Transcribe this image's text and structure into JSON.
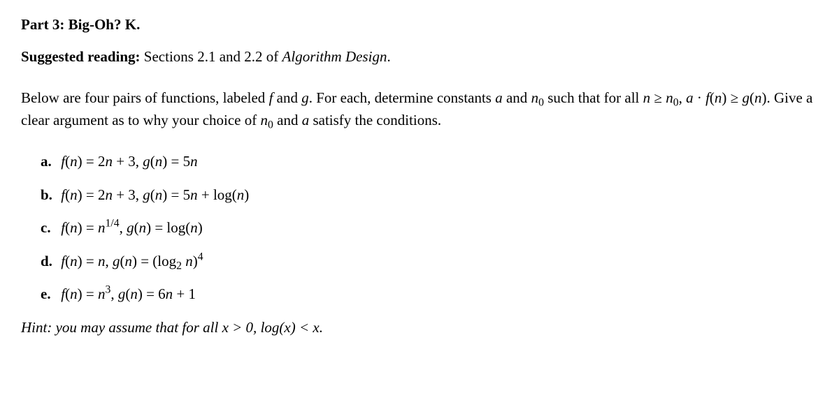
{
  "heading": "Part 3: Big-Oh? K.",
  "reading": {
    "label": "Suggested reading:",
    "text_before": " Sections 2.1 and 2.2 of ",
    "book": "Algorithm Design",
    "text_after": "."
  },
  "instructions": {
    "l1_a": "Below are four pairs of functions, labeled ",
    "l1_b": " and ",
    "l1_c": ". For each, determine constants ",
    "l1_d": " and ",
    "l1_e": " such that for all ",
    "l2_a": ", ",
    "l2_b": ". Give a clear argument as to why your choice of ",
    "l2_c": " and ",
    "l2_d": " satisfy the conditions.",
    "f": "f",
    "g": "g",
    "a": "a",
    "n0": "n",
    "n0_sub": "0",
    "cond1_a": "n",
    "cond1_b": " ≥ ",
    "cond1_c": "n",
    "cond2_a": "a",
    "cond2_b": " · ",
    "cond2_c": "f",
    "cond2_d": "(",
    "cond2_e": "n",
    "cond2_f": ") ≥ ",
    "cond2_g": "g",
    "cond2_h": "(",
    "cond2_i": "n",
    "cond2_j": ")"
  },
  "items": {
    "a": {
      "label": "a.",
      "f_lhs": "f",
      "g_lhs": "g",
      "n": "n",
      "eq": " = ",
      "f_rhs_a": "2",
      "f_rhs_b": " + 3",
      "g_rhs_a": "5"
    },
    "b": {
      "label": "b.",
      "f_lhs": "f",
      "g_lhs": "g",
      "n": "n",
      "eq": " = ",
      "f_rhs_a": "2",
      "f_rhs_b": " + 3",
      "g_rhs_a": "5",
      "g_rhs_b": " + log(",
      "g_rhs_c": ")"
    },
    "c": {
      "label": "c.",
      "f_lhs": "f",
      "g_lhs": "g",
      "n": "n",
      "eq": " = ",
      "exp": "1/4",
      "g_rhs_a": "log(",
      "g_rhs_b": ")"
    },
    "d": {
      "label": "d.",
      "f_lhs": "f",
      "g_lhs": "g",
      "n": "n",
      "eq": " = ",
      "g_rhs_a": "(log",
      "g_sub": "2",
      "g_rhs_b": " ",
      "g_rhs_c": ")",
      "g_exp": "4"
    },
    "e": {
      "label": "e.",
      "f_lhs": "f",
      "g_lhs": "g",
      "n": "n",
      "eq": " = ",
      "exp": "3",
      "g_rhs_a": "6",
      "g_rhs_b": " + 1"
    }
  },
  "hint": {
    "a": "Hint: you may assume that for all ",
    "x1": "x",
    "b": " > 0, ",
    "c": "log(",
    "x2": "x",
    "d": ") < ",
    "x3": "x",
    "e": "."
  },
  "paren_open": "(",
  "paren_close": ")",
  "comma_sep": ", "
}
